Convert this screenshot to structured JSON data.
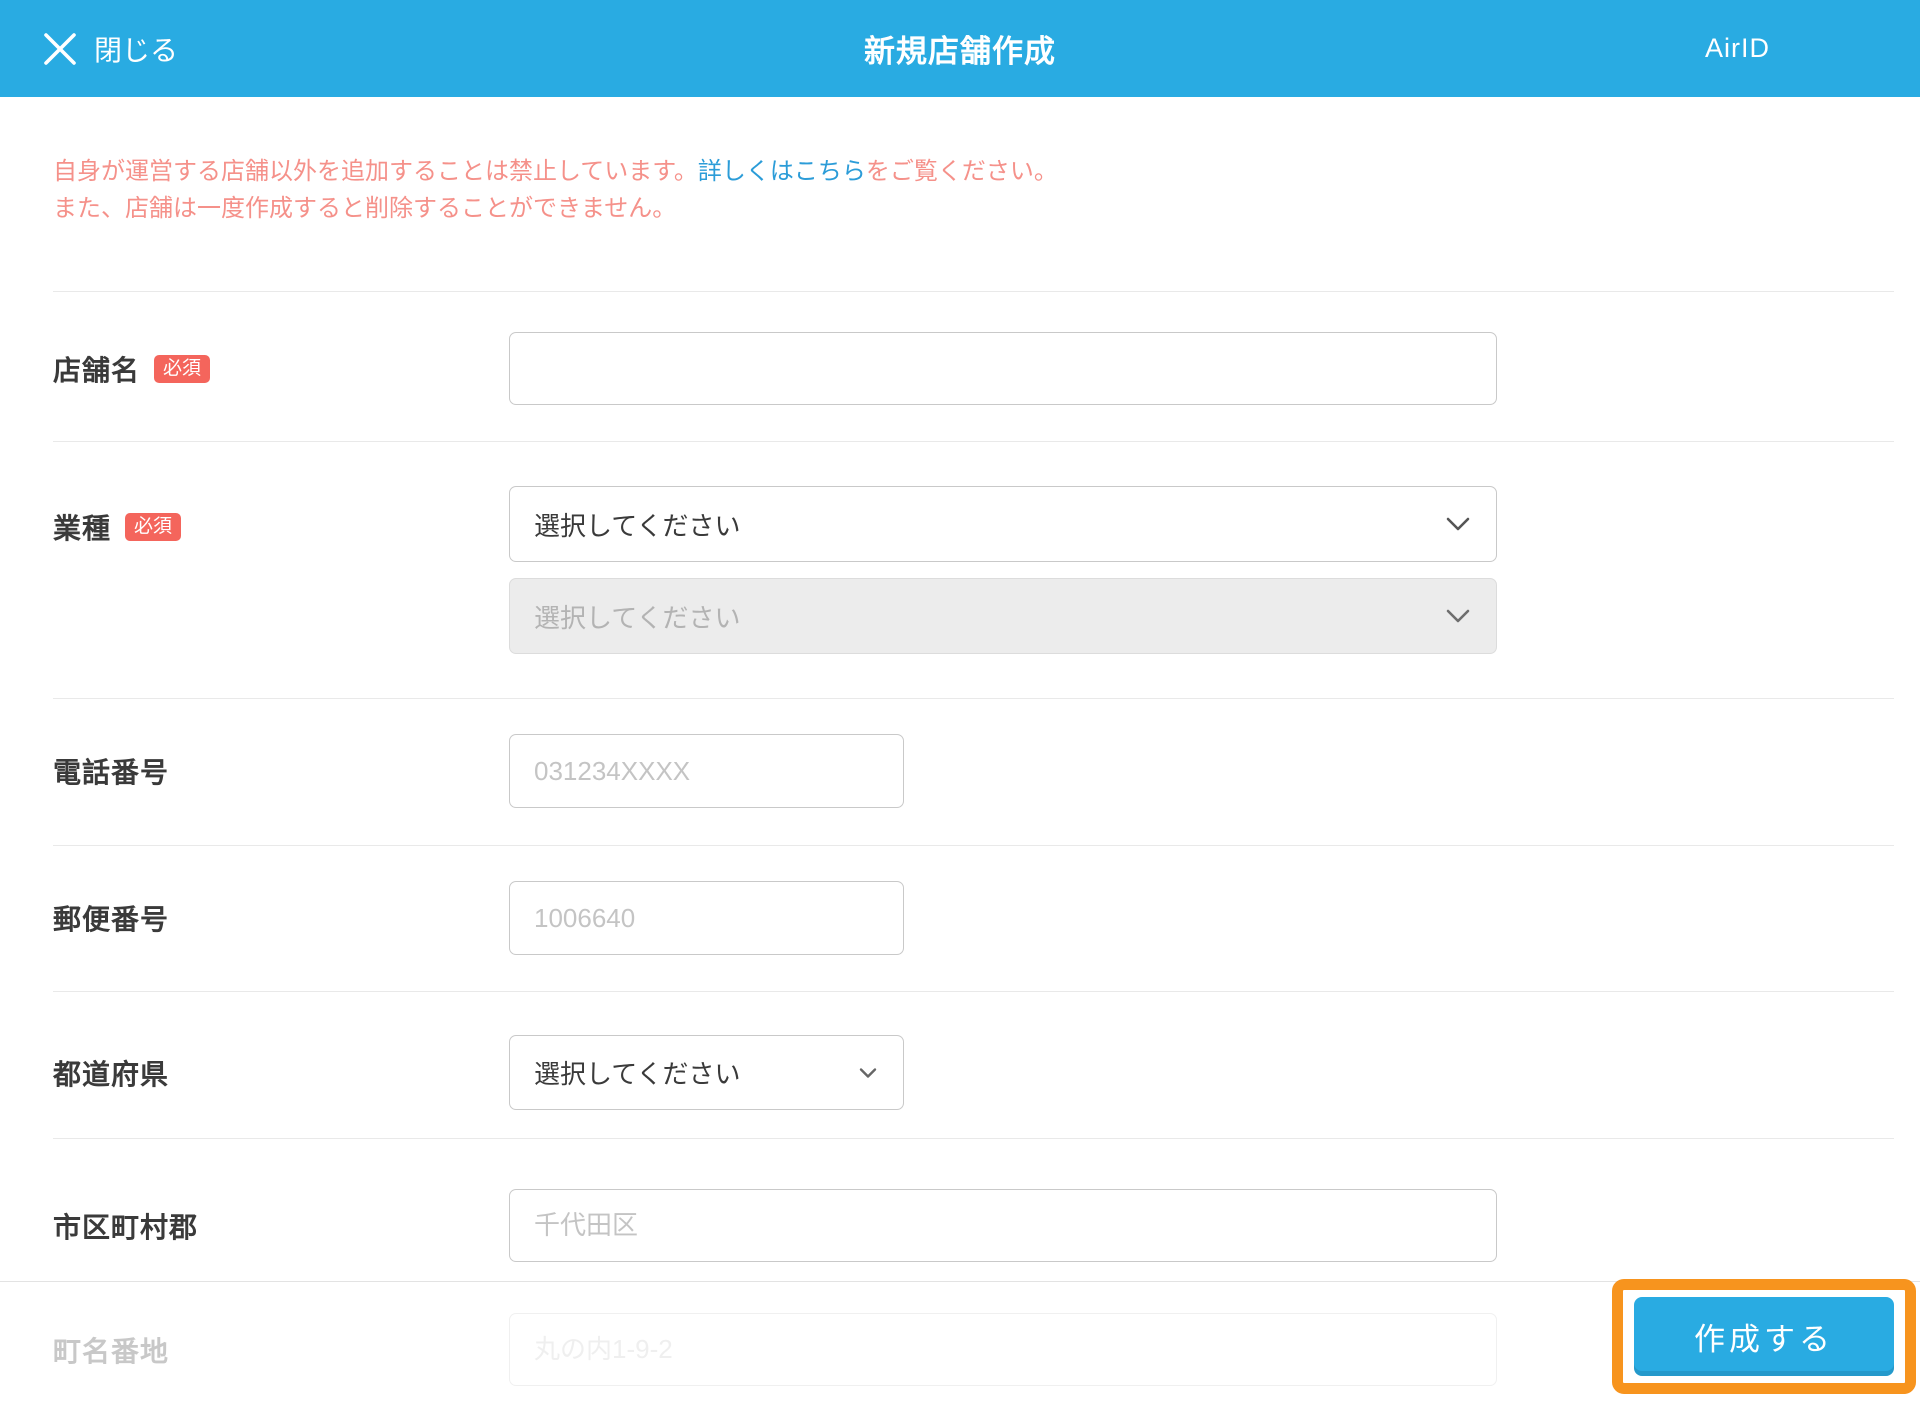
{
  "header": {
    "close_label": "閉じる",
    "title": "新規店舗作成",
    "brand": "AirID"
  },
  "notice": {
    "line1_pre": "自身が運営する店舗以外を追加することは禁止しています。",
    "line1_link": "詳しくはこちら",
    "line1_post": "をご覧ください。",
    "line2": "また、店舗は一度作成すると削除することができません。"
  },
  "badges": {
    "required": "必須"
  },
  "form": {
    "fields": [
      {
        "label": "店舗名",
        "required": true,
        "type": "text",
        "value": "",
        "placeholder": ""
      },
      {
        "label": "業種",
        "required": true,
        "type": "double-select",
        "select1": "選択してください",
        "select2": "選択してください",
        "select2_disabled": true
      },
      {
        "label": "電話番号",
        "required": false,
        "type": "text",
        "placeholder": "031234XXXX"
      },
      {
        "label": "郵便番号",
        "required": false,
        "type": "text",
        "placeholder": "1006640"
      },
      {
        "label": "都道府県",
        "required": false,
        "type": "select",
        "value": "選択してください"
      },
      {
        "label": "市区町村郡",
        "required": false,
        "type": "text",
        "placeholder": "千代田区"
      },
      {
        "label": "町名番地",
        "required": false,
        "type": "text",
        "placeholder": "丸の内1-9-2"
      }
    ]
  },
  "footer": {
    "create_label": "作成する"
  },
  "colors": {
    "header_bg": "#29ABE2",
    "warning_text": "#F5918A",
    "link_text": "#2B9CD8",
    "required_badge_bg": "#F4655C",
    "highlight_border": "#F7941E",
    "create_button_bg": "#29ABE2",
    "divider": "#e9e9e9"
  }
}
